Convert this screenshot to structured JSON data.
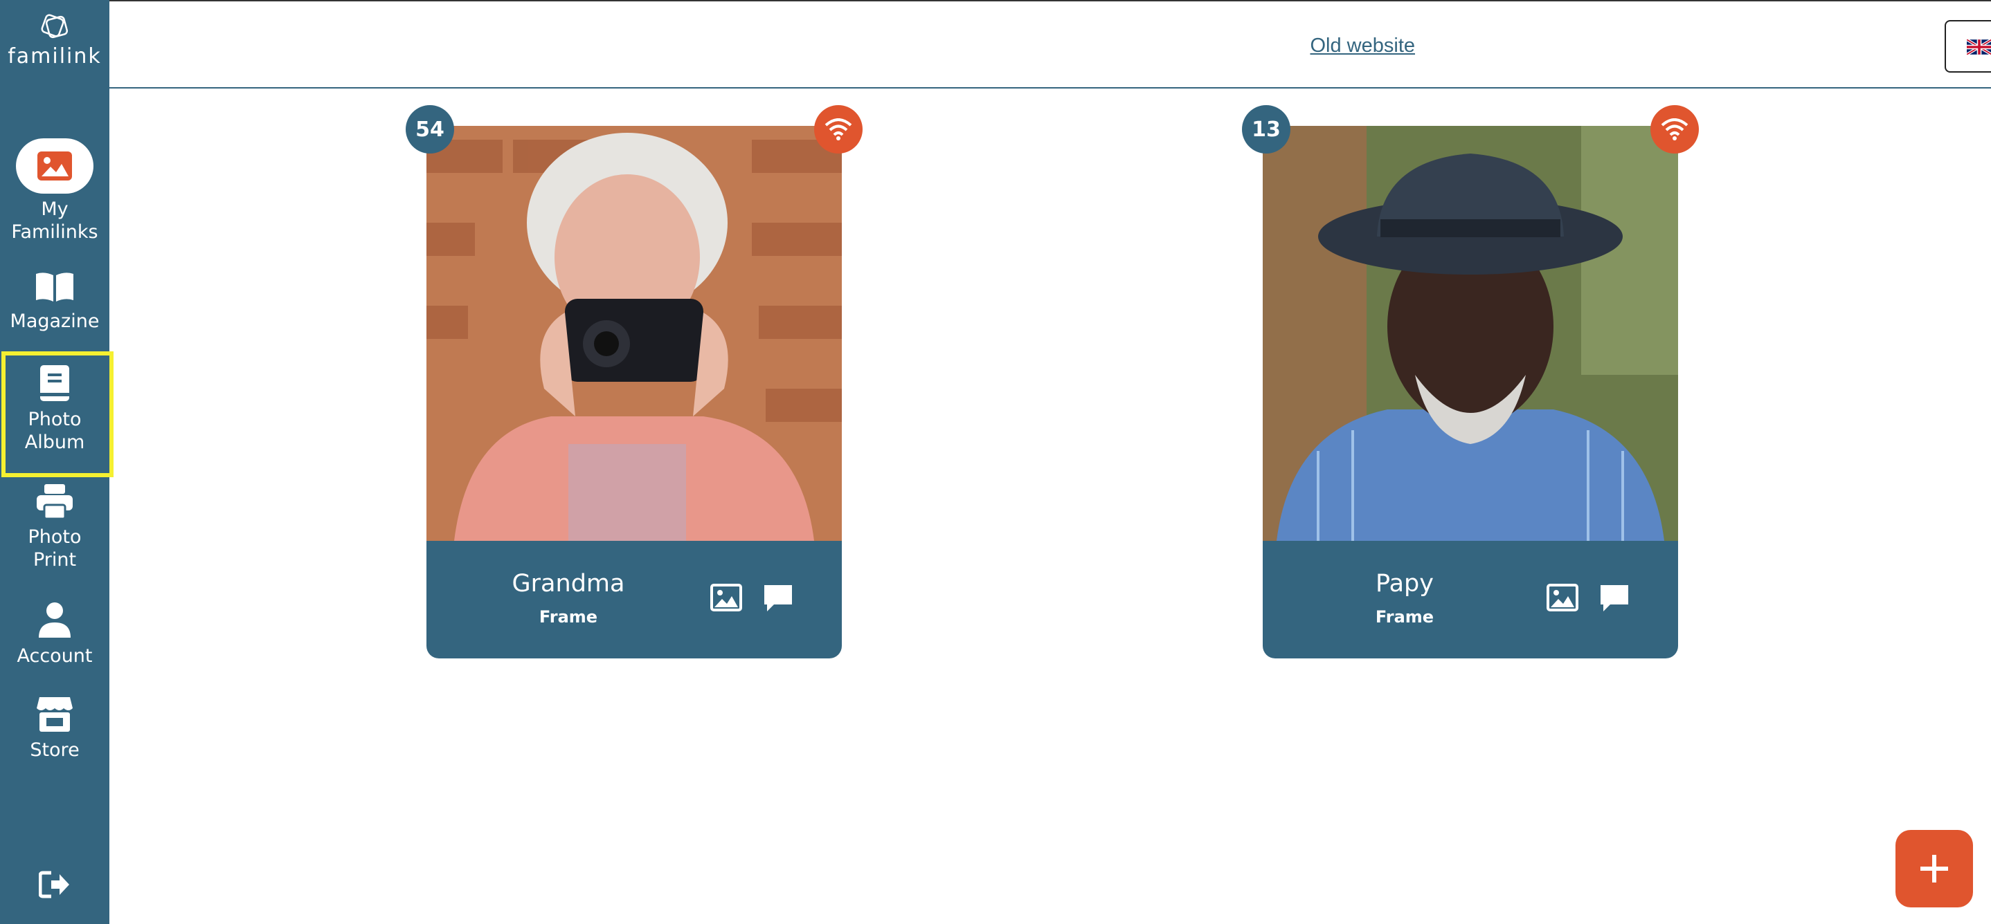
{
  "app": {
    "logo_text": "familink"
  },
  "sidebar": {
    "items": [
      {
        "label_line1": "My",
        "label_line2": "Familinks",
        "icon": "image-icon"
      },
      {
        "label_line1": "Magazine",
        "label_line2": "",
        "icon": "book-open-icon"
      },
      {
        "label_line1": "Photo",
        "label_line2": "Album",
        "icon": "album-icon"
      },
      {
        "label_line1": "Photo",
        "label_line2": "Print",
        "icon": "printer-icon"
      },
      {
        "label_line1": "Account",
        "label_line2": "",
        "icon": "user-icon"
      },
      {
        "label_line1": "Store",
        "label_line2": "",
        "icon": "store-icon"
      }
    ],
    "logout_icon": "logout-icon"
  },
  "header": {
    "old_website": "Old website",
    "language_flag": "🇬🇧",
    "help": "?"
  },
  "frames": [
    {
      "name": "Grandma",
      "type": "Frame",
      "photo_count": "54",
      "status_icon": "wifi-icon"
    },
    {
      "name": "Papy",
      "type": "Frame",
      "photo_count": "13",
      "status_icon": "wifi-icon"
    }
  ],
  "colors": {
    "brand": "#34657f",
    "accent": "#e0552e",
    "highlight": "#f5f031"
  }
}
